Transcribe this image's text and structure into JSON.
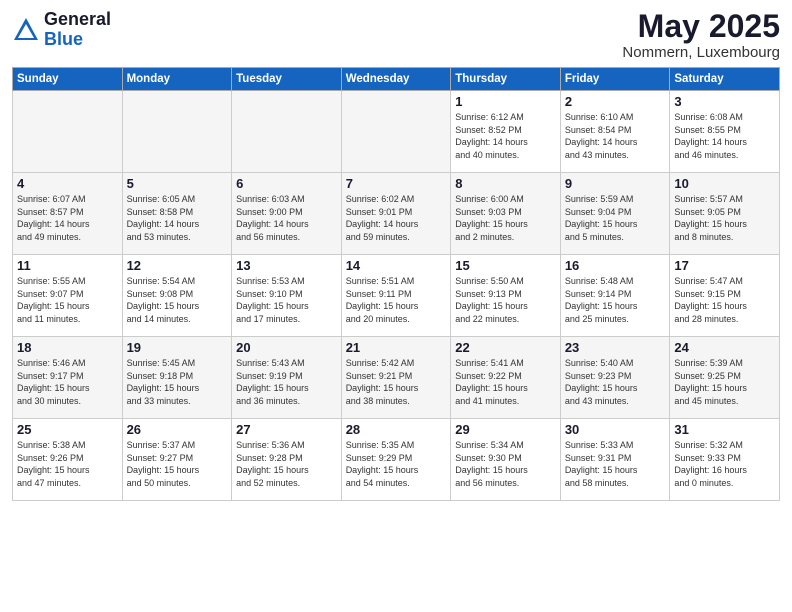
{
  "header": {
    "logo_general": "General",
    "logo_blue": "Blue",
    "month_title": "May 2025",
    "location": "Nommern, Luxembourg"
  },
  "days_of_week": [
    "Sunday",
    "Monday",
    "Tuesday",
    "Wednesday",
    "Thursday",
    "Friday",
    "Saturday"
  ],
  "weeks": [
    [
      {
        "day": "",
        "info": "",
        "empty": true
      },
      {
        "day": "",
        "info": "",
        "empty": true
      },
      {
        "day": "",
        "info": "",
        "empty": true
      },
      {
        "day": "",
        "info": "",
        "empty": true
      },
      {
        "day": "1",
        "info": "Sunrise: 6:12 AM\nSunset: 8:52 PM\nDaylight: 14 hours\nand 40 minutes."
      },
      {
        "day": "2",
        "info": "Sunrise: 6:10 AM\nSunset: 8:54 PM\nDaylight: 14 hours\nand 43 minutes."
      },
      {
        "day": "3",
        "info": "Sunrise: 6:08 AM\nSunset: 8:55 PM\nDaylight: 14 hours\nand 46 minutes."
      }
    ],
    [
      {
        "day": "4",
        "info": "Sunrise: 6:07 AM\nSunset: 8:57 PM\nDaylight: 14 hours\nand 49 minutes."
      },
      {
        "day": "5",
        "info": "Sunrise: 6:05 AM\nSunset: 8:58 PM\nDaylight: 14 hours\nand 53 minutes."
      },
      {
        "day": "6",
        "info": "Sunrise: 6:03 AM\nSunset: 9:00 PM\nDaylight: 14 hours\nand 56 minutes."
      },
      {
        "day": "7",
        "info": "Sunrise: 6:02 AM\nSunset: 9:01 PM\nDaylight: 14 hours\nand 59 minutes."
      },
      {
        "day": "8",
        "info": "Sunrise: 6:00 AM\nSunset: 9:03 PM\nDaylight: 15 hours\nand 2 minutes."
      },
      {
        "day": "9",
        "info": "Sunrise: 5:59 AM\nSunset: 9:04 PM\nDaylight: 15 hours\nand 5 minutes."
      },
      {
        "day": "10",
        "info": "Sunrise: 5:57 AM\nSunset: 9:05 PM\nDaylight: 15 hours\nand 8 minutes."
      }
    ],
    [
      {
        "day": "11",
        "info": "Sunrise: 5:55 AM\nSunset: 9:07 PM\nDaylight: 15 hours\nand 11 minutes."
      },
      {
        "day": "12",
        "info": "Sunrise: 5:54 AM\nSunset: 9:08 PM\nDaylight: 15 hours\nand 14 minutes."
      },
      {
        "day": "13",
        "info": "Sunrise: 5:53 AM\nSunset: 9:10 PM\nDaylight: 15 hours\nand 17 minutes."
      },
      {
        "day": "14",
        "info": "Sunrise: 5:51 AM\nSunset: 9:11 PM\nDaylight: 15 hours\nand 20 minutes."
      },
      {
        "day": "15",
        "info": "Sunrise: 5:50 AM\nSunset: 9:13 PM\nDaylight: 15 hours\nand 22 minutes."
      },
      {
        "day": "16",
        "info": "Sunrise: 5:48 AM\nSunset: 9:14 PM\nDaylight: 15 hours\nand 25 minutes."
      },
      {
        "day": "17",
        "info": "Sunrise: 5:47 AM\nSunset: 9:15 PM\nDaylight: 15 hours\nand 28 minutes."
      }
    ],
    [
      {
        "day": "18",
        "info": "Sunrise: 5:46 AM\nSunset: 9:17 PM\nDaylight: 15 hours\nand 30 minutes."
      },
      {
        "day": "19",
        "info": "Sunrise: 5:45 AM\nSunset: 9:18 PM\nDaylight: 15 hours\nand 33 minutes."
      },
      {
        "day": "20",
        "info": "Sunrise: 5:43 AM\nSunset: 9:19 PM\nDaylight: 15 hours\nand 36 minutes."
      },
      {
        "day": "21",
        "info": "Sunrise: 5:42 AM\nSunset: 9:21 PM\nDaylight: 15 hours\nand 38 minutes."
      },
      {
        "day": "22",
        "info": "Sunrise: 5:41 AM\nSunset: 9:22 PM\nDaylight: 15 hours\nand 41 minutes."
      },
      {
        "day": "23",
        "info": "Sunrise: 5:40 AM\nSunset: 9:23 PM\nDaylight: 15 hours\nand 43 minutes."
      },
      {
        "day": "24",
        "info": "Sunrise: 5:39 AM\nSunset: 9:25 PM\nDaylight: 15 hours\nand 45 minutes."
      }
    ],
    [
      {
        "day": "25",
        "info": "Sunrise: 5:38 AM\nSunset: 9:26 PM\nDaylight: 15 hours\nand 47 minutes."
      },
      {
        "day": "26",
        "info": "Sunrise: 5:37 AM\nSunset: 9:27 PM\nDaylight: 15 hours\nand 50 minutes."
      },
      {
        "day": "27",
        "info": "Sunrise: 5:36 AM\nSunset: 9:28 PM\nDaylight: 15 hours\nand 52 minutes."
      },
      {
        "day": "28",
        "info": "Sunrise: 5:35 AM\nSunset: 9:29 PM\nDaylight: 15 hours\nand 54 minutes."
      },
      {
        "day": "29",
        "info": "Sunrise: 5:34 AM\nSunset: 9:30 PM\nDaylight: 15 hours\nand 56 minutes."
      },
      {
        "day": "30",
        "info": "Sunrise: 5:33 AM\nSunset: 9:31 PM\nDaylight: 15 hours\nand 58 minutes."
      },
      {
        "day": "31",
        "info": "Sunrise: 5:32 AM\nSunset: 9:33 PM\nDaylight: 16 hours\nand 0 minutes."
      }
    ]
  ]
}
